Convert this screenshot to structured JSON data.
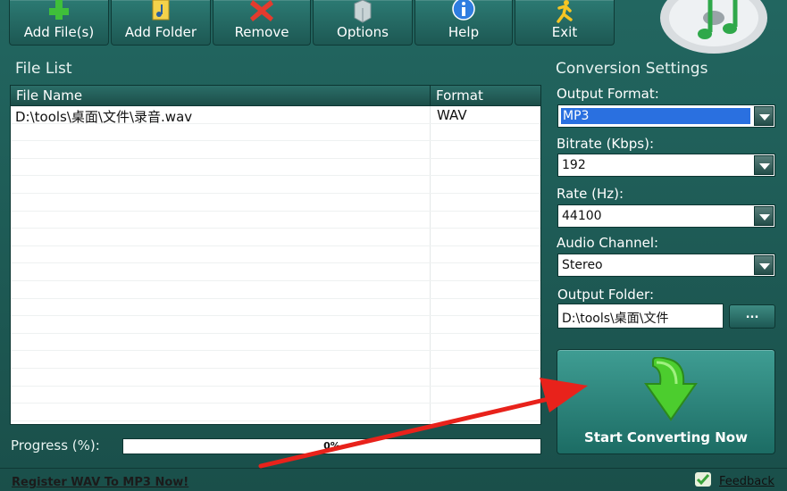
{
  "toolbar": {
    "add_files": "Add File(s)",
    "add_folder": "Add Folder",
    "remove": "Remove",
    "options": "Options",
    "help": "Help",
    "exit": "Exit"
  },
  "file_list": {
    "title": "File List",
    "col_name": "File Name",
    "col_format": "Format",
    "rows": [
      {
        "name": "D:\\tools\\桌面\\文件\\录音.wav",
        "format": "WAV"
      }
    ]
  },
  "progress": {
    "label": "Progress (%):",
    "value": 0,
    "text": "0%"
  },
  "settings": {
    "title": "Conversion Settings",
    "output_format_label": "Output Format:",
    "output_format": "MP3",
    "bitrate_label": "Bitrate (Kbps):",
    "bitrate": "192",
    "rate_label": "Rate (Hz):",
    "rate": "44100",
    "channel_label": "Audio Channel:",
    "channel": "Stereo",
    "folder_label": "Output Folder:",
    "folder": "D:\\tools\\桌面\\文件",
    "browse": "...",
    "start": "Start Converting Now"
  },
  "footer": {
    "register": "Register WAV To MP3 Now!",
    "feedback": "Feedback"
  },
  "colors": {
    "background": "#1f5b55",
    "annotation_arrow": "#e8221b"
  }
}
